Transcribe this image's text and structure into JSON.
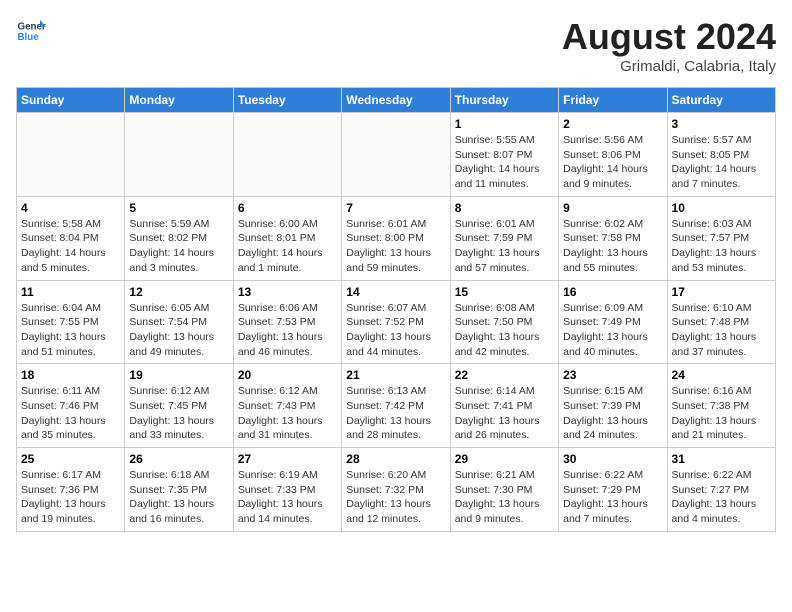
{
  "header": {
    "logo_line1": "General",
    "logo_line2": "Blue",
    "month_title": "August 2024",
    "subtitle": "Grimaldi, Calabria, Italy"
  },
  "weekdays": [
    "Sunday",
    "Monday",
    "Tuesday",
    "Wednesday",
    "Thursday",
    "Friday",
    "Saturday"
  ],
  "weeks": [
    [
      {
        "day": "",
        "info": ""
      },
      {
        "day": "",
        "info": ""
      },
      {
        "day": "",
        "info": ""
      },
      {
        "day": "",
        "info": ""
      },
      {
        "day": "1",
        "info": "Sunrise: 5:55 AM\nSunset: 8:07 PM\nDaylight: 14 hours\nand 11 minutes."
      },
      {
        "day": "2",
        "info": "Sunrise: 5:56 AM\nSunset: 8:06 PM\nDaylight: 14 hours\nand 9 minutes."
      },
      {
        "day": "3",
        "info": "Sunrise: 5:57 AM\nSunset: 8:05 PM\nDaylight: 14 hours\nand 7 minutes."
      }
    ],
    [
      {
        "day": "4",
        "info": "Sunrise: 5:58 AM\nSunset: 8:04 PM\nDaylight: 14 hours\nand 5 minutes."
      },
      {
        "day": "5",
        "info": "Sunrise: 5:59 AM\nSunset: 8:02 PM\nDaylight: 14 hours\nand 3 minutes."
      },
      {
        "day": "6",
        "info": "Sunrise: 6:00 AM\nSunset: 8:01 PM\nDaylight: 14 hours\nand 1 minute."
      },
      {
        "day": "7",
        "info": "Sunrise: 6:01 AM\nSunset: 8:00 PM\nDaylight: 13 hours\nand 59 minutes."
      },
      {
        "day": "8",
        "info": "Sunrise: 6:01 AM\nSunset: 7:59 PM\nDaylight: 13 hours\nand 57 minutes."
      },
      {
        "day": "9",
        "info": "Sunrise: 6:02 AM\nSunset: 7:58 PM\nDaylight: 13 hours\nand 55 minutes."
      },
      {
        "day": "10",
        "info": "Sunrise: 6:03 AM\nSunset: 7:57 PM\nDaylight: 13 hours\nand 53 minutes."
      }
    ],
    [
      {
        "day": "11",
        "info": "Sunrise: 6:04 AM\nSunset: 7:55 PM\nDaylight: 13 hours\nand 51 minutes."
      },
      {
        "day": "12",
        "info": "Sunrise: 6:05 AM\nSunset: 7:54 PM\nDaylight: 13 hours\nand 49 minutes."
      },
      {
        "day": "13",
        "info": "Sunrise: 6:06 AM\nSunset: 7:53 PM\nDaylight: 13 hours\nand 46 minutes."
      },
      {
        "day": "14",
        "info": "Sunrise: 6:07 AM\nSunset: 7:52 PM\nDaylight: 13 hours\nand 44 minutes."
      },
      {
        "day": "15",
        "info": "Sunrise: 6:08 AM\nSunset: 7:50 PM\nDaylight: 13 hours\nand 42 minutes."
      },
      {
        "day": "16",
        "info": "Sunrise: 6:09 AM\nSunset: 7:49 PM\nDaylight: 13 hours\nand 40 minutes."
      },
      {
        "day": "17",
        "info": "Sunrise: 6:10 AM\nSunset: 7:48 PM\nDaylight: 13 hours\nand 37 minutes."
      }
    ],
    [
      {
        "day": "18",
        "info": "Sunrise: 6:11 AM\nSunset: 7:46 PM\nDaylight: 13 hours\nand 35 minutes."
      },
      {
        "day": "19",
        "info": "Sunrise: 6:12 AM\nSunset: 7:45 PM\nDaylight: 13 hours\nand 33 minutes."
      },
      {
        "day": "20",
        "info": "Sunrise: 6:12 AM\nSunset: 7:43 PM\nDaylight: 13 hours\nand 31 minutes."
      },
      {
        "day": "21",
        "info": "Sunrise: 6:13 AM\nSunset: 7:42 PM\nDaylight: 13 hours\nand 28 minutes."
      },
      {
        "day": "22",
        "info": "Sunrise: 6:14 AM\nSunset: 7:41 PM\nDaylight: 13 hours\nand 26 minutes."
      },
      {
        "day": "23",
        "info": "Sunrise: 6:15 AM\nSunset: 7:39 PM\nDaylight: 13 hours\nand 24 minutes."
      },
      {
        "day": "24",
        "info": "Sunrise: 6:16 AM\nSunset: 7:38 PM\nDaylight: 13 hours\nand 21 minutes."
      }
    ],
    [
      {
        "day": "25",
        "info": "Sunrise: 6:17 AM\nSunset: 7:36 PM\nDaylight: 13 hours\nand 19 minutes."
      },
      {
        "day": "26",
        "info": "Sunrise: 6:18 AM\nSunset: 7:35 PM\nDaylight: 13 hours\nand 16 minutes."
      },
      {
        "day": "27",
        "info": "Sunrise: 6:19 AM\nSunset: 7:33 PM\nDaylight: 13 hours\nand 14 minutes."
      },
      {
        "day": "28",
        "info": "Sunrise: 6:20 AM\nSunset: 7:32 PM\nDaylight: 13 hours\nand 12 minutes."
      },
      {
        "day": "29",
        "info": "Sunrise: 6:21 AM\nSunset: 7:30 PM\nDaylight: 13 hours\nand 9 minutes."
      },
      {
        "day": "30",
        "info": "Sunrise: 6:22 AM\nSunset: 7:29 PM\nDaylight: 13 hours\nand 7 minutes."
      },
      {
        "day": "31",
        "info": "Sunrise: 6:22 AM\nSunset: 7:27 PM\nDaylight: 13 hours\nand 4 minutes."
      }
    ]
  ]
}
